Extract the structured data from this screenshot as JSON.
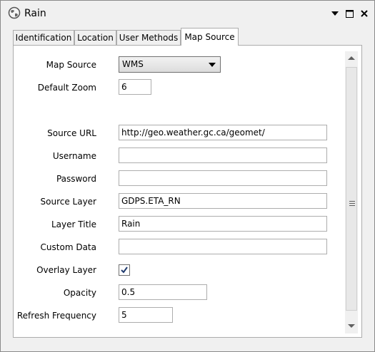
{
  "window": {
    "title": "Rain",
    "icon": "globe-icon",
    "controls": [
      "dropdown-icon",
      "maximize-icon",
      "close-icon"
    ]
  },
  "tabs": [
    {
      "label": "Identification",
      "active": false
    },
    {
      "label": "Location",
      "active": false
    },
    {
      "label": "User Methods",
      "active": false
    },
    {
      "label": "Map Source",
      "active": true
    }
  ],
  "form": {
    "map_source": {
      "label": "Map Source",
      "value": "WMS"
    },
    "default_zoom": {
      "label": "Default Zoom",
      "value": "6"
    },
    "source_url": {
      "label": "Source URL",
      "value": "http://geo.weather.gc.ca/geomet/"
    },
    "username": {
      "label": "Username",
      "value": ""
    },
    "password": {
      "label": "Password",
      "value": ""
    },
    "source_layer": {
      "label": "Source Layer",
      "value": "GDPS.ETA_RN"
    },
    "layer_title": {
      "label": "Layer Title",
      "value": "Rain"
    },
    "custom_data": {
      "label": "Custom Data",
      "value": ""
    },
    "overlay_layer": {
      "label": "Overlay Layer",
      "checked": true
    },
    "opacity": {
      "label": "Opacity",
      "value": "0.5"
    },
    "refresh_frequency": {
      "label": "Refresh Frequency",
      "value": "5"
    }
  }
}
